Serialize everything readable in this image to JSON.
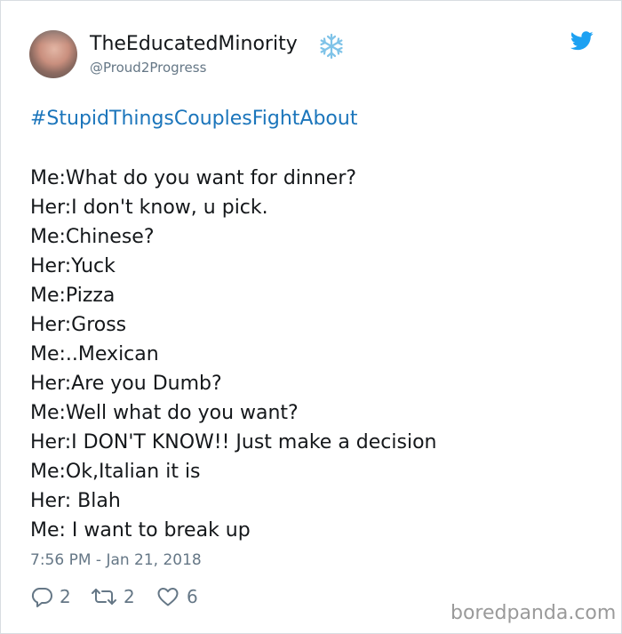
{
  "tweet": {
    "display_name": "TheEducatedMinority",
    "display_name_emoji": "snowflake-icon",
    "handle": "@Proud2Progress",
    "hashtag": "#StupidThingsCouplesFightAbout",
    "lines": [
      "Me:What do you want for dinner?",
      "Her:I don't know, u pick.",
      "Me:Chinese?",
      "Her:Yuck",
      "Me:Pizza",
      "Her:Gross",
      "Me:..Mexican",
      "Her:Are you Dumb?",
      "Me:Well what do you want?",
      "Her:I DON'T KNOW!! Just make a decision",
      "Me:Ok,Italian it is",
      "Her: Blah",
      "Me: I want to break up"
    ],
    "timestamp": "7:56 PM - Jan 21, 2018",
    "actions": {
      "reply": {
        "icon": "reply-icon",
        "count": "2"
      },
      "retweet": {
        "icon": "retweet-icon",
        "count": "2"
      },
      "like": {
        "icon": "heart-icon",
        "count": "6"
      }
    }
  },
  "brand": {
    "platform_icon": "twitter-bird-icon",
    "watermark": "boredpanda.com"
  },
  "colors": {
    "link": "#1b75bb",
    "muted": "#657786",
    "text": "#14171a",
    "twitter_blue": "#1da1f2",
    "snowflake": "#7fc3e8",
    "border": "#d8dde1",
    "watermark": "#9a9a9a"
  }
}
